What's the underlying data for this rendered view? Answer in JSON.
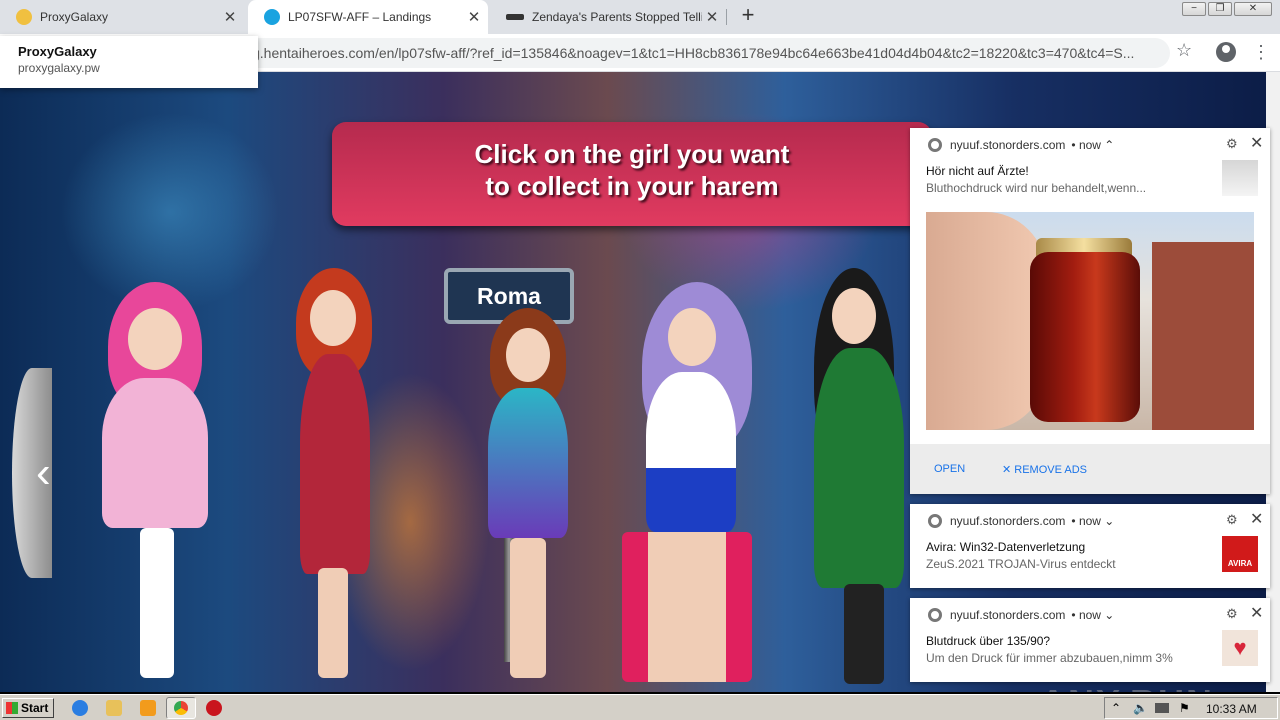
{
  "browser": {
    "tabs": [
      {
        "title": "ProxyGalaxy",
        "active": false
      },
      {
        "title": "LP07SFW-AFF – Landings",
        "active": true
      },
      {
        "title": "Zendaya's Parents Stopped Telling H",
        "active": false
      }
    ],
    "url": "g.hentaiheroes.com/en/lp07sfw-aff/?ref_id=135846&noagev=1&tc1=HH8cb836178e94bc64e663be41d04d4b04&tc2=18220&tc3=470&tc4=S...",
    "popup": {
      "title": "ProxyGalaxy",
      "url": "proxygalaxy.pw"
    },
    "new_tab": "+",
    "window_controls": [
      "−",
      "❐",
      "✕"
    ]
  },
  "page": {
    "banner": {
      "line1": "Click on the girl you want",
      "line2": "to collect in your harem"
    },
    "sign": "Roma",
    "prev_arrow": "‹"
  },
  "notifications": [
    {
      "source": "nyuuf.stonorders.com",
      "time": "now",
      "title": "Hör nicht auf Ärzte!",
      "body": "Bluthochdruck wird nur behandelt,wenn...",
      "actions": {
        "open": "OPEN",
        "remove": "REMOVE ADS"
      }
    },
    {
      "source": "nyuuf.stonorders.com",
      "time": "now",
      "title": "Avira: Win32-Datenverletzung",
      "body": "ZeuS.2021 TROJAN-Virus entdeckt",
      "badge": "AVIRA"
    },
    {
      "source": "nyuuf.stonorders.com",
      "time": "now",
      "title": "Blutdruck über 135/90?",
      "body": "Um den Druck für immer abzubauen,nimm 3%"
    }
  ],
  "taskbar": {
    "start": "Start",
    "clock": "10:33 AM"
  },
  "watermark": "ANY.RUN",
  "colors": {
    "banner": "#e13b60",
    "link": "#1a73e8",
    "avira": "#d11a1a"
  }
}
